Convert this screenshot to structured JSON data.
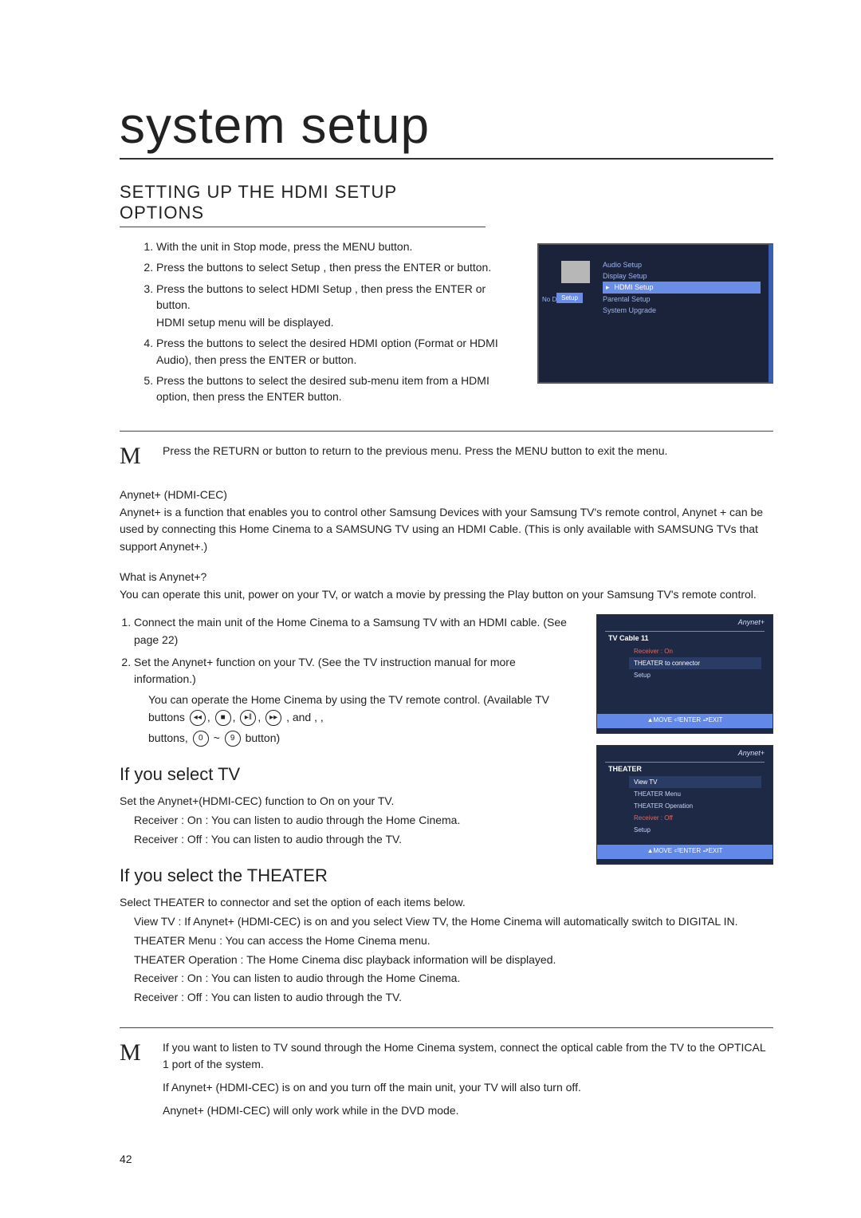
{
  "title": "system setup",
  "section_heading": "SETTING UP THE HDMI SETUP OPTIONS",
  "steps": [
    "With the unit in Stop mode, press the MENU button.",
    "Press the       buttons to select Setup , then press the ENTER or       button.",
    "Press the       buttons to select HDMI Setup , then press the ENTER or       button.",
    "Press the       buttons to select the desired HDMI option (Format or HDMI Audio), then press the ENTER or       button.",
    "Press the       buttons to select the desired sub-menu item from a HDMI option, then press the ENTER button."
  ],
  "step3_sub": "HDMI setup menu will be displayed.",
  "osd1": {
    "left_label": "No Disc",
    "tab": "Setup",
    "items": [
      "Audio Setup",
      "Display Setup",
      "HDMI Setup",
      "Parental Setup",
      "System Upgrade"
    ]
  },
  "note1": "Press the RETURN or       button to return to the previous menu. Press the MENU button to exit the menu.",
  "anynet_heading": "Anynet+ (HDMI-CEC)",
  "anynet_para": "Anynet+ is a function that enables you to control other Samsung Devices with your Samsung TV's remote control, Anynet + can be used by connecting this Home Cinema to a SAMSUNG TV using an HDMI Cable. (This is only available with SAMSUNG TVs that support Anynet+.)",
  "what_heading": "What is Anynet+?",
  "what_para": "You can operate this unit, power on your TV, or watch a movie by pressing the Play button on your Samsung TV's remote control.",
  "numlist": [
    "Connect the main unit of the Home Cinema to a Samsung TV with an HDMI cable. (See page 22)",
    "Set the Anynet+ function on your TV. (See the TV instruction manual for more information.)"
  ],
  "numlist_inner": [
    "You can operate the Home Cinema by using the TV remote control. (Available TV buttons",
    "buttons,",
    "button)"
  ],
  "k_and": ",     and ,   ,",
  "osd2": {
    "header": "TV Cable 11",
    "rows": [
      {
        "label": "Receiver :",
        "val": "On",
        "cls": "recv"
      },
      {
        "label": "THEATER to connector",
        "cls": "sel"
      },
      {
        "label": "Setup",
        "cls": ""
      }
    ],
    "foot": "▲MOVE  ⏎ENTER  ⮐EXIT"
  },
  "tv_heading": "If you select TV",
  "tv_body": [
    "Set the Anynet+(HDMI-CEC) function to On on your TV.",
    "Receiver : On  : You can listen to audio through the Home Cinema.",
    "Receiver : Off  : You can listen to audio through the TV."
  ],
  "osd3": {
    "header": "THEATER",
    "rows": [
      {
        "label": "View TV",
        "cls": "sel"
      },
      {
        "label": "THEATER Menu",
        "cls": ""
      },
      {
        "label": "THEATER Operation",
        "cls": ""
      },
      {
        "label": "Receiver :     Off",
        "cls": "recv"
      },
      {
        "label": "Setup",
        "cls": ""
      }
    ],
    "foot": "▲MOVE  ⏎ENTER  ⮐EXIT"
  },
  "theater_heading": "If you select the THEATER",
  "theater_body": [
    "Select THEATER to connector  and set the option of each items below.",
    "View TV : If Anynet+ (HDMI-CEC) is on and you select View TV, the Home Cinema will automatically switch to DIGITAL IN.",
    "THEATER Menu : You can access the Home Cinema menu.",
    "THEATER Operation : The Home Cinema disc playback information will be displayed.",
    "Receiver : On  : You can listen to audio through the Home Cinema.",
    "Receiver : Off  : You can listen to audio through the TV."
  ],
  "note2": [
    "If you want to listen to TV sound through the Home Cinema system, connect the optical cable from the TV to the OPTICAL 1 port of the system.",
    "If Anynet+ (HDMI-CEC) is on and you turn off the main unit, your TV will also turn off.",
    "Anynet+ (HDMI-CEC) will only work while in the DVD mode."
  ],
  "page_number": "42",
  "anynet_logo": "Anynet+"
}
